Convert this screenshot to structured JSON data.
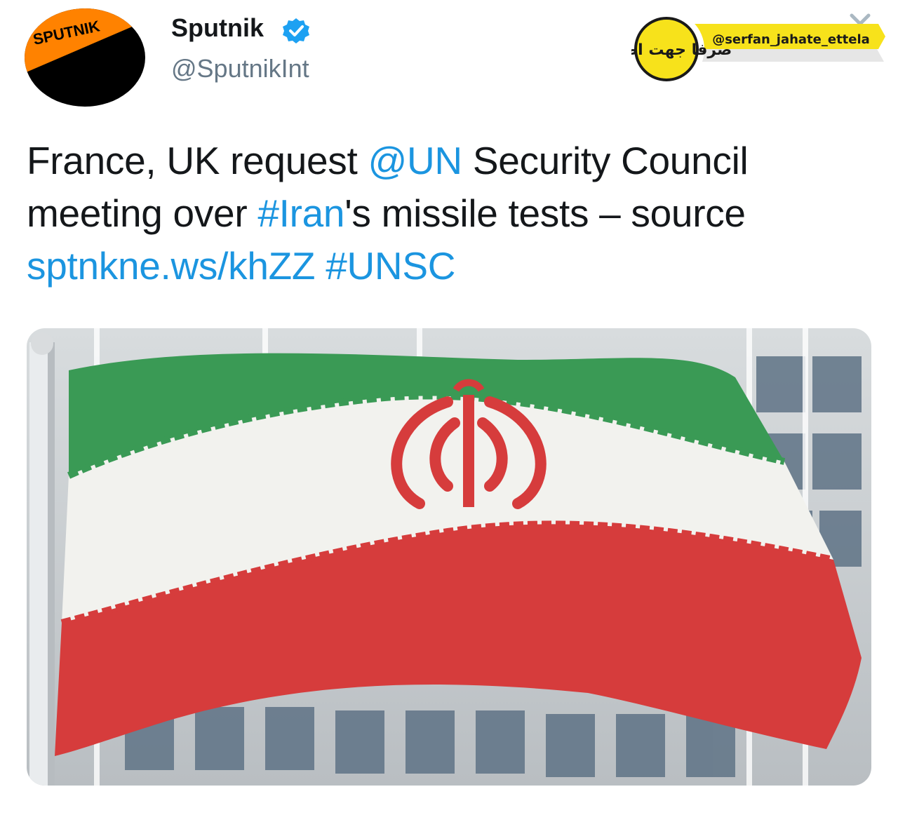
{
  "tweet": {
    "display_name": "Sputnik",
    "handle": "@SputnikInt",
    "avatar_text": "SPUTNIK",
    "text_parts": {
      "t1": "France, UK request ",
      "mention": "@UN",
      "t2": " Security Council",
      "t3": "meeting over ",
      "hashtag1": "#Iran",
      "t4": "'s missile tests – source",
      "url": "sptnkne.ws/khZZ",
      "t5": " ",
      "hashtag2": "#UNSC"
    }
  },
  "watermark": {
    "handle": "@serfan_jahate_ettela",
    "logo_text": "صرفا جهت اطلاع"
  },
  "media": {
    "subject": "Iranian flag waving in front of a building"
  },
  "colors": {
    "link": "#1b95e0",
    "verified": "#1da1f2",
    "avatar_orange": "#ff8200",
    "avatar_black": "#000000",
    "flag_green": "#3a9a55",
    "flag_white": "#f2f2ee",
    "flag_red": "#d63c3c"
  },
  "icons": {
    "verified": "verified-badge-icon",
    "close": "close-icon"
  }
}
